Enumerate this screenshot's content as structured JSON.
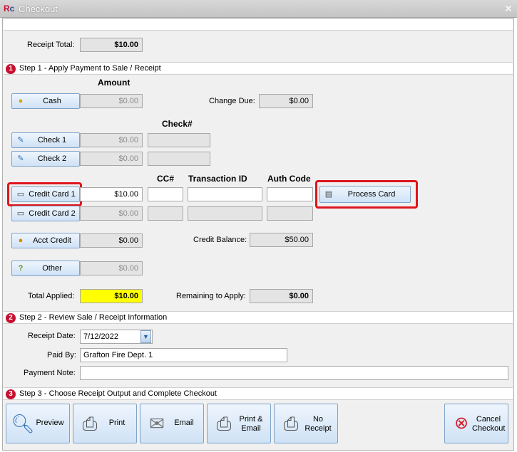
{
  "window": {
    "title": "Checkout"
  },
  "receipt_total": {
    "label": "Receipt Total:",
    "value": "$10.00"
  },
  "step1": {
    "number": "1",
    "title": "Step 1 - Apply Payment to Sale / Receipt"
  },
  "headers": {
    "amount": "Amount",
    "check_num": "Check#",
    "cc_num": "CC#",
    "transaction_id": "Transaction ID",
    "auth_code": "Auth Code"
  },
  "cash": {
    "label": "Cash",
    "amount": "$0.00"
  },
  "change_due": {
    "label": "Change Due:",
    "value": "$0.00"
  },
  "check1": {
    "label": "Check 1",
    "amount": "$0.00",
    "check_num": ""
  },
  "check2": {
    "label": "Check 2",
    "amount": "$0.00",
    "check_num": ""
  },
  "credit_card1": {
    "label": "Credit Card 1",
    "amount": "$10.00",
    "cc_num": "",
    "transaction_id": "",
    "auth_code": ""
  },
  "credit_card2": {
    "label": "Credit Card 2",
    "amount": "$0.00",
    "cc_num": "",
    "transaction_id": "",
    "auth_code": ""
  },
  "process_card": {
    "label": "Process Card"
  },
  "acct_credit": {
    "label": "Acct Credit",
    "amount": "$0.00"
  },
  "credit_balance": {
    "label": "Credit Balance:",
    "value": "$50.00"
  },
  "other": {
    "label": "Other",
    "amount": "$0.00"
  },
  "total_applied": {
    "label": "Total Applied:",
    "value": "$10.00"
  },
  "remaining": {
    "label": "Remaining to Apply:",
    "value": "$0.00"
  },
  "step2": {
    "number": "2",
    "title": "Step 2 - Review Sale / Receipt Information"
  },
  "receipt_date": {
    "label": "Receipt Date:",
    "value": "7/12/2022"
  },
  "paid_by": {
    "label": "Paid By:",
    "value": "Grafton Fire Dept. 1"
  },
  "payment_note": {
    "label": "Payment Note:",
    "value": ""
  },
  "step3": {
    "number": "3",
    "title": "Step 3 - Choose Receipt Output and Complete Checkout"
  },
  "output_buttons": {
    "preview": "Preview",
    "print": "Print",
    "email": "Email",
    "print_email_1": "Print &",
    "print_email_2": "Email",
    "no_receipt_1": "No",
    "no_receipt_2": "Receipt",
    "cancel_1": "Cancel",
    "cancel_2": "Checkout"
  },
  "colors": {
    "accent_red": "#e0141c",
    "step_badge": "#c8102e",
    "total_highlight": "#ffff00",
    "button_border": "#7fa3c9"
  }
}
